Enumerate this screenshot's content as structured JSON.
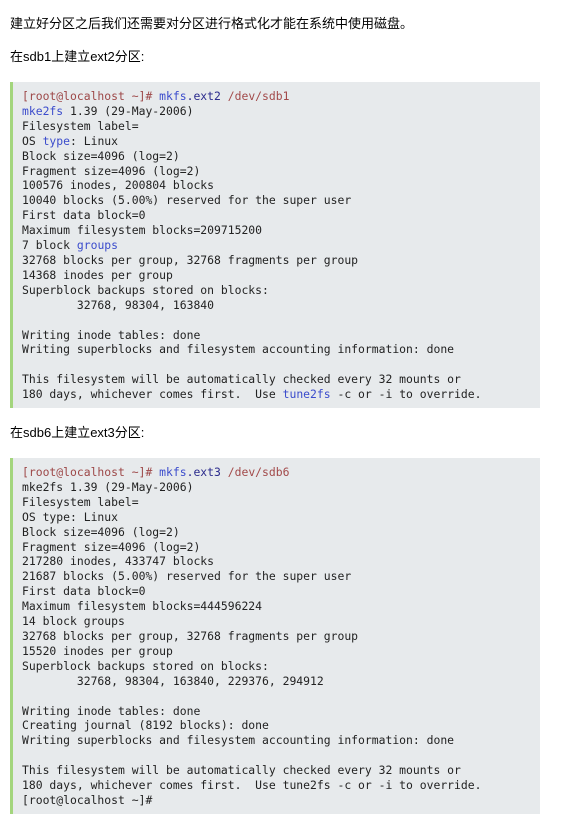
{
  "document": {
    "intro_text": "建立好分区之后我们还需要对分区进行格式化才能在系统中使用磁盘。",
    "heading_ext2": "在sdb1上建立ext2分区:",
    "heading_ext3": "在sdb6上建立ext3分区:",
    "colors": {
      "code_background": "#e7eaec",
      "code_border": "#a3d57d",
      "prompt": "#9d4848",
      "command": "#3b4ccc",
      "extension": "#2a2a8c",
      "path": "#a24a4a",
      "keyword": "#3b4ccc",
      "plain": "#222222",
      "page_background": "#ffffff",
      "body_text": "#000000"
    }
  },
  "code_block_ext2": {
    "name": "mkfs-ext2-terminal-output",
    "lines": [
      {
        "segments": [
          {
            "text": "[root@localhost ~]# ",
            "style": "prompt"
          },
          {
            "text": "mkfs",
            "style": "cmd"
          },
          {
            "text": ".ext2",
            "style": "ext"
          },
          {
            "text": " ",
            "style": "plain"
          },
          {
            "text": "/dev/sdb1",
            "style": "path"
          }
        ]
      },
      {
        "segments": [
          {
            "text": "mke2fs",
            "style": "kw"
          },
          {
            "text": " 1.39 (29-May-2006)",
            "style": "plain"
          }
        ]
      },
      {
        "segments": [
          {
            "text": "Filesystem label=",
            "style": "plain"
          }
        ]
      },
      {
        "segments": [
          {
            "text": "OS ",
            "style": "plain"
          },
          {
            "text": "type",
            "style": "kw"
          },
          {
            "text": ": Linux",
            "style": "plain"
          }
        ]
      },
      {
        "segments": [
          {
            "text": "Block size=4096 (log=2)",
            "style": "plain"
          }
        ]
      },
      {
        "segments": [
          {
            "text": "Fragment size=4096 (log=2)",
            "style": "plain"
          }
        ]
      },
      {
        "segments": [
          {
            "text": "100576 inodes, 200804 blocks",
            "style": "plain"
          }
        ]
      },
      {
        "segments": [
          {
            "text": "10040 blocks (5.00%) reserved for the super user",
            "style": "plain"
          }
        ]
      },
      {
        "segments": [
          {
            "text": "First data block=0",
            "style": "plain"
          }
        ]
      },
      {
        "segments": [
          {
            "text": "Maximum filesystem blocks=209715200",
            "style": "plain"
          }
        ]
      },
      {
        "segments": [
          {
            "text": "7 block ",
            "style": "plain"
          },
          {
            "text": "groups",
            "style": "kw"
          }
        ]
      },
      {
        "segments": [
          {
            "text": "32768 blocks per group, 32768 fragments per group",
            "style": "plain"
          }
        ]
      },
      {
        "segments": [
          {
            "text": "14368 inodes per group",
            "style": "plain"
          }
        ]
      },
      {
        "segments": [
          {
            "text": "Superblock backups stored on blocks:",
            "style": "plain"
          }
        ]
      },
      {
        "segments": [
          {
            "text": "        32768, 98304, 163840",
            "style": "plain"
          }
        ]
      },
      {
        "segments": [
          {
            "text": "",
            "style": "plain"
          }
        ]
      },
      {
        "segments": [
          {
            "text": "Writing inode tables: done",
            "style": "plain"
          }
        ]
      },
      {
        "segments": [
          {
            "text": "Writing superblocks and filesystem accounting information: done",
            "style": "plain"
          }
        ]
      },
      {
        "segments": [
          {
            "text": "",
            "style": "plain"
          }
        ]
      },
      {
        "segments": [
          {
            "text": "This filesystem will be automatically checked every 32 mounts or",
            "style": "plain"
          }
        ]
      },
      {
        "segments": [
          {
            "text": "180 days, whichever comes first.  Use ",
            "style": "plain"
          },
          {
            "text": "tune2fs",
            "style": "kw"
          },
          {
            "text": " -c or -i to override.",
            "style": "plain"
          }
        ]
      }
    ]
  },
  "code_block_ext3": {
    "name": "mkfs-ext3-terminal-output",
    "lines": [
      {
        "segments": [
          {
            "text": "[root@localhost ~]# ",
            "style": "prompt"
          },
          {
            "text": "mkfs",
            "style": "cmd"
          },
          {
            "text": ".ext3",
            "style": "ext"
          },
          {
            "text": " ",
            "style": "plain"
          },
          {
            "text": "/dev/sdb6",
            "style": "path"
          }
        ]
      },
      {
        "segments": [
          {
            "text": "mke2fs 1.39 (29-May-2006)",
            "style": "plain"
          }
        ]
      },
      {
        "segments": [
          {
            "text": "Filesystem label=",
            "style": "plain"
          }
        ]
      },
      {
        "segments": [
          {
            "text": "OS type: Linux",
            "style": "plain"
          }
        ]
      },
      {
        "segments": [
          {
            "text": "Block size=4096 (log=2)",
            "style": "plain"
          }
        ]
      },
      {
        "segments": [
          {
            "text": "Fragment size=4096 (log=2)",
            "style": "plain"
          }
        ]
      },
      {
        "segments": [
          {
            "text": "217280 inodes, 433747 blocks",
            "style": "plain"
          }
        ]
      },
      {
        "segments": [
          {
            "text": "21687 blocks (5.00%) reserved for the super user",
            "style": "plain"
          }
        ]
      },
      {
        "segments": [
          {
            "text": "First data block=0",
            "style": "plain"
          }
        ]
      },
      {
        "segments": [
          {
            "text": "Maximum filesystem blocks=444596224",
            "style": "plain"
          }
        ]
      },
      {
        "segments": [
          {
            "text": "14 block groups",
            "style": "plain"
          }
        ]
      },
      {
        "segments": [
          {
            "text": "32768 blocks per group, 32768 fragments per group",
            "style": "plain"
          }
        ]
      },
      {
        "segments": [
          {
            "text": "15520 inodes per group",
            "style": "plain"
          }
        ]
      },
      {
        "segments": [
          {
            "text": "Superblock backups stored on blocks:",
            "style": "plain"
          }
        ]
      },
      {
        "segments": [
          {
            "text": "        32768, 98304, 163840, 229376, 294912",
            "style": "plain"
          }
        ]
      },
      {
        "segments": [
          {
            "text": "",
            "style": "plain"
          }
        ]
      },
      {
        "segments": [
          {
            "text": "Writing inode tables: done",
            "style": "plain"
          }
        ]
      },
      {
        "segments": [
          {
            "text": "Creating journal (8192 blocks): done",
            "style": "plain"
          }
        ]
      },
      {
        "segments": [
          {
            "text": "Writing superblocks and filesystem accounting information: done",
            "style": "plain"
          }
        ]
      },
      {
        "segments": [
          {
            "text": "",
            "style": "plain"
          }
        ]
      },
      {
        "segments": [
          {
            "text": "This filesystem will be automatically checked every 32 mounts or",
            "style": "plain"
          }
        ]
      },
      {
        "segments": [
          {
            "text": "180 days, whichever comes first.  Use tune2fs -c or -i to override.",
            "style": "plain"
          }
        ]
      },
      {
        "segments": [
          {
            "text": "[root@localhost ~]#",
            "style": "plain"
          }
        ]
      }
    ]
  }
}
